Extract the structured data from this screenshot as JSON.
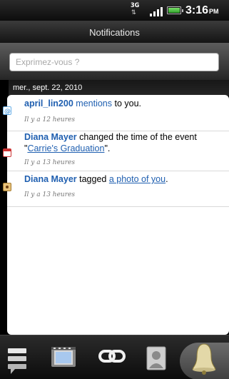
{
  "status_bar": {
    "network": "3G",
    "time": "3:16",
    "ampm": "PM"
  },
  "title": "Notifications",
  "status_input": {
    "placeholder": "Exprimez-vous ?"
  },
  "date_header": "mer., sept. 22, 2010",
  "notifications": [
    {
      "icon": "mention-icon",
      "name": "april_lin200",
      "action": "mentions",
      "rest": " to you.",
      "time": "Il y a 12 heures"
    },
    {
      "icon": "calendar-icon",
      "name": "Diana Mayer",
      "text1": " changed the time of the event \"",
      "event": "Carrie's Graduation",
      "text2": "\".",
      "time": "Il y a 13 heures"
    },
    {
      "icon": "photo-icon",
      "name": "Diana Mayer",
      "text1": " tagged ",
      "link": "a photo of you",
      "text2": ".",
      "time": "Il y a 13 heures"
    }
  ],
  "bottom_tabs": [
    "updates-tab",
    "media-tab",
    "links-tab",
    "contacts-tab",
    "notifications-tab"
  ],
  "colors": {
    "link": "#1f5fb0",
    "background": "#000000"
  }
}
